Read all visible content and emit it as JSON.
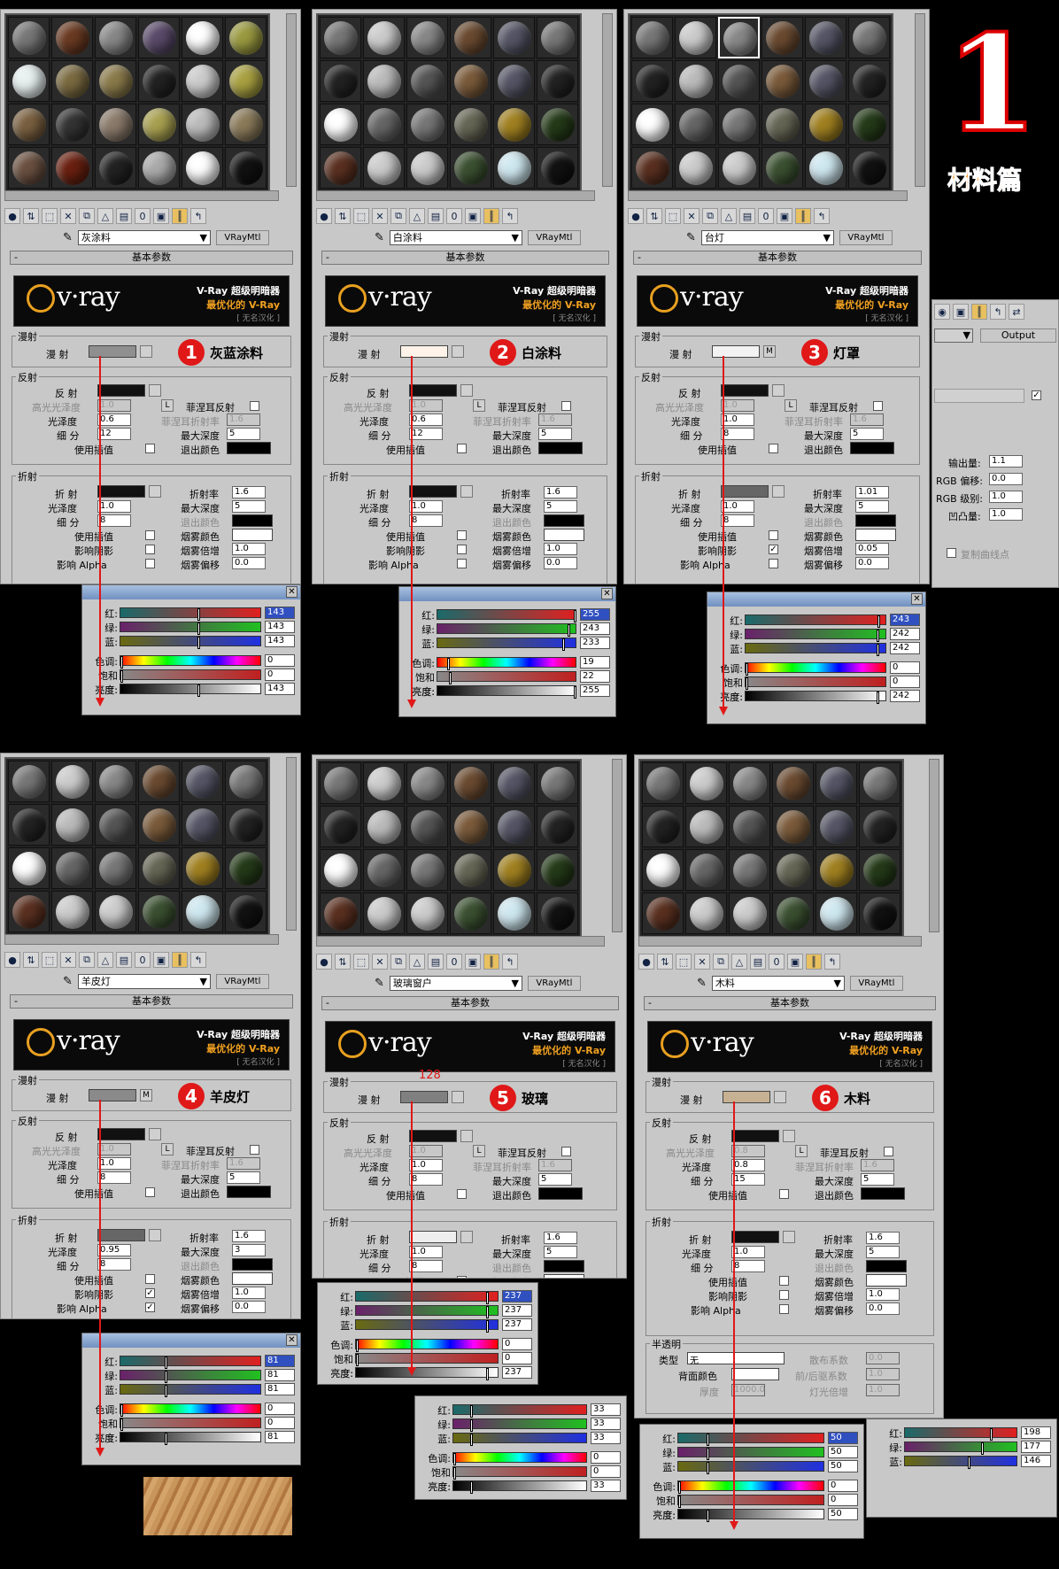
{
  "page_title": "1",
  "page_subtitle": "材料篇",
  "common": {
    "rollout_label": "基本参数",
    "type_button": "VRayMtl",
    "vray_line1": "V-Ray 超级明暗器",
    "vray_line2": "最优化的 V-Ray",
    "vray_line3": "[ 无名汉化 ]",
    "logo": "v·ray",
    "group_diffuse": "漫射",
    "group_reflect": "反射",
    "group_refract": "折射",
    "diffuse_label": "漫 射",
    "reflect_label": "反 射",
    "hilight_gloss": "高光光泽度",
    "gloss": "光泽度",
    "subdiv": "细 分",
    "use_interp": "使用插值",
    "fresnel": "菲涅耳反射",
    "fresnel_ior": "菲涅耳折射率",
    "max_depth": "最大深度",
    "exit_color": "退出颜色",
    "refract_label": "折 射",
    "ior": "折射率",
    "fog_color": "烟雾颜色",
    "fog_mult": "烟雾倍增",
    "fog_bias": "烟雾偏移",
    "affect_shadows": "影响阴影",
    "affect_alpha": "影响 Alpha",
    "L": "L",
    "M": "M",
    "color_red": "红:",
    "color_green": "绿:",
    "color_blue": "蓝:",
    "color_hue": "色调:",
    "color_sat": "饱和度:",
    "color_val": "亮度:",
    "close": "✕",
    "translucent_label": "半透明",
    "trans_type": "类型",
    "trans_type_val": "无",
    "trans_back_color": "背面颜色",
    "trans_thickness": "厚度",
    "trans_scatter": "散布系数",
    "trans_fwd_back": "前/后驱系数",
    "trans_light_mult": "灯光倍增"
  },
  "panels": [
    {
      "name": "灰涂料",
      "number": "1",
      "label": "灰蓝涂料",
      "ior_val": "1.6",
      "gloss_val": "0.6",
      "hgloss_val": "1.0",
      "subdiv_val": "12",
      "maxdepth": "5",
      "fres_ior": "1.6",
      "r_ior": "1.6",
      "r_gloss": "1.0",
      "r_subdiv": "8",
      "r_maxdepth": "5",
      "fog_mult_val": "1.0",
      "fog_bias_val": "0.0",
      "rgb": {
        "r": "143",
        "g": "143",
        "b": "143",
        "h": "0",
        "s": "0",
        "v": "143"
      }
    },
    {
      "name": "白涂料",
      "number": "2",
      "label": "白涂料",
      "ior_val": "1.6",
      "gloss_val": "0.6",
      "hgloss_val": "1.0",
      "subdiv_val": "12",
      "maxdepth": "5",
      "fres_ior": "1.6",
      "r_ior": "1.6",
      "r_gloss": "1.0",
      "r_subdiv": "8",
      "r_maxdepth": "5",
      "fog_mult_val": "1.0",
      "fog_bias_val": "0.0",
      "rgb": {
        "r": "255",
        "g": "243",
        "b": "233",
        "h": "19",
        "s": "22",
        "v": "255"
      }
    },
    {
      "name": "台灯",
      "number": "3",
      "label": "灯罩",
      "gloss_val": "1.0",
      "hgloss_val": "1.0",
      "subdiv_val": "8",
      "maxdepth": "5",
      "fres_ior": "1.6",
      "r_ior": "1.01",
      "r_gloss": "1.0",
      "r_subdiv": "8",
      "r_maxdepth": "5",
      "fog_mult_val": "0.05",
      "fog_bias_val": "0.0",
      "rgb": {
        "r": "243",
        "g": "242",
        "b": "242",
        "h": "0",
        "s": "0",
        "v": "242"
      }
    },
    {
      "name": "羊皮灯",
      "number": "4",
      "label": "羊皮灯",
      "gloss_val": "1.0",
      "hgloss_val": "1.0",
      "subdiv_val": "8",
      "maxdepth": "5",
      "fres_ior": "1.6",
      "r_ior": "1.6",
      "r_gloss": "0.95",
      "r_subdiv": "8",
      "r_maxdepth": "3",
      "fog_mult_val": "1.0",
      "fog_bias_val": "0.0",
      "rgb": {
        "r": "81",
        "g": "81",
        "b": "81",
        "h": "0",
        "s": "0",
        "v": "81"
      }
    },
    {
      "name": "玻璃窗户",
      "number": "5",
      "label": "玻璃",
      "annot": "128",
      "gloss_val": "1.0",
      "hgloss_val": "1.0",
      "subdiv_val": "8",
      "maxdepth": "5",
      "fres_ior": "1.6",
      "r_ior": "1.6",
      "r_gloss": "1.0",
      "r_subdiv": "8",
      "r_maxdepth": "5",
      "rgb": {
        "r": "237",
        "g": "237",
        "b": "237",
        "h": "0",
        "s": "0",
        "v": "237"
      },
      "rgb2": {
        "r": "33",
        "g": "33",
        "b": "33",
        "h": "0",
        "s": "0",
        "v": "33"
      }
    },
    {
      "name": "木料",
      "number": "6",
      "label": "木料",
      "gloss_val": "0.8",
      "hgloss_val": "0.8",
      "subdiv_val": "15",
      "maxdepth": "5",
      "fres_ior": "1.6",
      "r_ior": "1.6",
      "r_gloss": "1.0",
      "r_subdiv": "8",
      "r_maxdepth": "5",
      "fog_mult_val": "1.0",
      "fog_bias_val": "0.0",
      "trans_thick_val": "1000.0",
      "trans_scatter_val": "0.0",
      "trans_fb_val": "1.0",
      "trans_lm_val": "1.0",
      "rgb": {
        "r": "50",
        "g": "50",
        "b": "50",
        "h": "0",
        "s": "0",
        "v": "50"
      },
      "rgb2": {
        "r": "198",
        "g": "177",
        "b": "146"
      }
    }
  ],
  "output_panel": {
    "output_label": "Output",
    "out_amount": "输出量:",
    "out_amount_val": "1.1",
    "rgb_offset": "RGB 偏移:",
    "rgb_offset_val": "0.0",
    "rgb_level": "RGB 级别:",
    "rgb_level_val": "1.0",
    "bump": "凹凸量:",
    "bump_val": "1.0",
    "copy_curve": "复制曲线点"
  },
  "colors": {
    "accent": "#e01818",
    "panel": "#c8c8c8"
  }
}
